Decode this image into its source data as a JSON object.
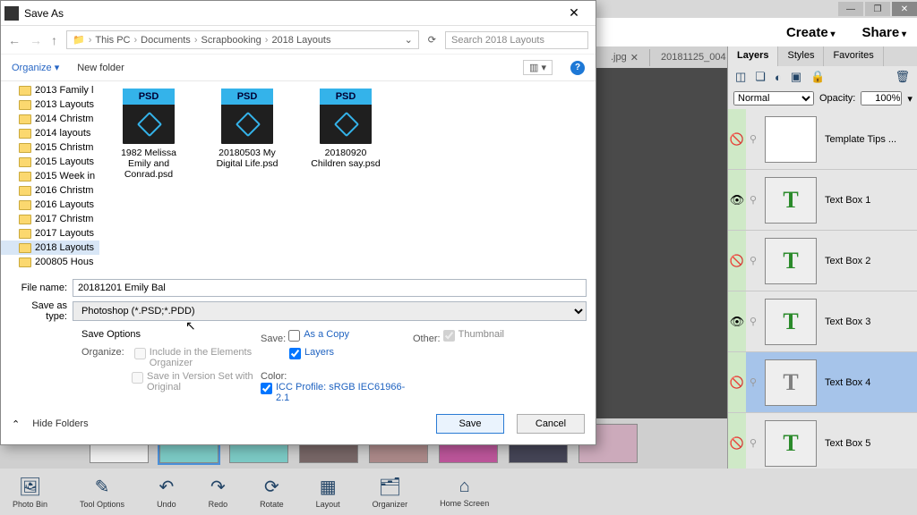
{
  "window": {
    "minimize": "—",
    "maximize": "❐",
    "close": "✕"
  },
  "topbar": {
    "create": "Create",
    "share": "Share"
  },
  "doc_tabs": [
    {
      "label": ".jpg"
    },
    {
      "label": "20181125_004"
    }
  ],
  "layers_panel": {
    "tabs": {
      "layers": "Layers",
      "styles": "Styles",
      "favorites": "Favorites"
    },
    "blend_mode": "Normal",
    "opacity_label": "Opacity:",
    "opacity_value": "100%",
    "rows": [
      {
        "visible": false,
        "name": "Template Tips ...",
        "type": "image"
      },
      {
        "visible": true,
        "name": "Text Box 1",
        "type": "text"
      },
      {
        "visible": false,
        "name": "Text Box 2",
        "type": "text"
      },
      {
        "visible": true,
        "name": "Text Box 3",
        "type": "text"
      },
      {
        "visible": false,
        "name": "Text Box 4",
        "type": "text",
        "selected": true
      },
      {
        "visible": false,
        "name": "Text Box 5",
        "type": "text"
      }
    ]
  },
  "bottom_tools": [
    {
      "label": "Photo Bin",
      "icon": "🖼"
    },
    {
      "label": "Tool Options",
      "icon": "✎"
    },
    {
      "label": "Undo",
      "icon": "↶"
    },
    {
      "label": "Redo",
      "icon": "↷"
    },
    {
      "label": "Rotate",
      "icon": "⟳"
    },
    {
      "label": "Layout",
      "icon": "▦"
    },
    {
      "label": "Organizer",
      "icon": "🗂"
    },
    {
      "label": "Home Screen",
      "icon": "⌂"
    }
  ],
  "dialog": {
    "title": "Save As",
    "close": "✕",
    "crumbs": [
      "This PC",
      "Documents",
      "Scrapbooking",
      "2018 Layouts"
    ],
    "search_placeholder": "Search 2018 Layouts",
    "organize": "Organize",
    "new_folder": "New folder",
    "view_menu": "▥ ▾",
    "folders": [
      "2013 Family l",
      "2013 Layouts",
      "2014 Christm",
      "2014 layouts",
      "2015 Christm",
      "2015 Layouts",
      "2015 Week in",
      "2016 Christm",
      "2016 Layouts",
      "2017 Christm",
      "2017 Layouts",
      "2018 Layouts",
      "200805 Hous"
    ],
    "selected_folder_index": 11,
    "files": [
      "1982 Melissa Emily and Conrad.psd",
      "20180503 My Digital Life.psd",
      "20180920 Children say.psd"
    ],
    "filename_label": "File name:",
    "filename_value": "20181201 Emily Bal",
    "savetype_label": "Save as type:",
    "savetype_value": "Photoshop (*.PSD;*.PDD)",
    "save_options_label": "Save Options",
    "organize_label": "Organize:",
    "include_organizer": "Include in the Elements Organizer",
    "save_version_set": "Save in Version Set with Original",
    "save_section": "Save:",
    "as_a_copy": "As a Copy",
    "layers_chk": "Layers",
    "color_section": "Color:",
    "icc_profile": "ICC Profile: sRGB IEC61966-2.1",
    "other_section": "Other:",
    "thumbnail": "Thumbnail",
    "hide_folders": "Hide Folders",
    "save_btn": "Save",
    "cancel_btn": "Cancel"
  }
}
